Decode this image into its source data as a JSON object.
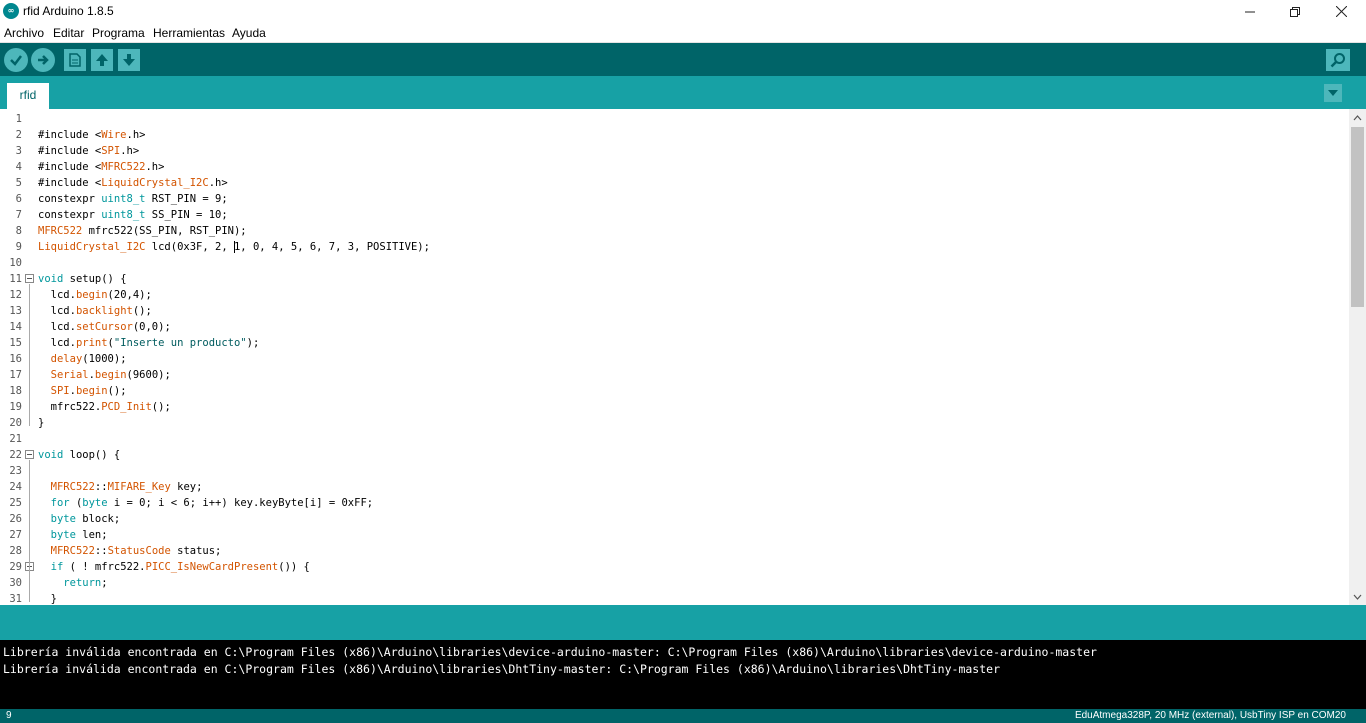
{
  "window": {
    "title": "rfid Arduino 1.8.5",
    "app_icon": "arduino-logo"
  },
  "menu": [
    "Archivo",
    "Editar",
    "Programa",
    "Herramientas",
    "Ayuda"
  ],
  "toolbar": {
    "buttons": [
      "verify-check",
      "upload-arrow",
      "new-file",
      "open-up-arrow",
      "save-down-arrow"
    ],
    "serial_monitor": "magnifier"
  },
  "tabs": [
    {
      "label": "rfid"
    }
  ],
  "editor": {
    "line_numbers": [
      "1",
      "2",
      "3",
      "4",
      "5",
      "6",
      "7",
      "8",
      "9",
      "10",
      "11",
      "12",
      "13",
      "14",
      "15",
      "16",
      "17",
      "18",
      "19",
      "20",
      "21",
      "22",
      "23",
      "24",
      "25",
      "26",
      "27",
      "28",
      "29",
      "30",
      "31"
    ],
    "lines": [
      "",
      "#include <Wire.h>",
      "#include <SPI.h>",
      "#include <MFRC522.h>",
      "#include <LiquidCrystal_I2C.h>",
      "constexpr uint8_t RST_PIN = 9;",
      "constexpr uint8_t SS_PIN = 10;",
      "MFRC522 mfrc522(SS_PIN, RST_PIN);",
      "LiquidCrystal_I2C lcd(0x3F, 2, 1, 0, 4, 5, 6, 7, 3, POSITIVE);",
      "",
      "void setup() {",
      "  lcd.begin(20,4);",
      "  lcd.backlight();",
      "  lcd.setCursor(0,0);",
      "  lcd.print(\"Inserte un producto\");",
      "  delay(1000);",
      "  Serial.begin(9600);",
      "  SPI.begin();",
      "  mfrc522.PCD_Init();",
      "}",
      "",
      "void loop() {",
      "",
      "  MFRC522::MIFARE_Key key;",
      "  for (byte i = 0; i < 6; i++) key.keyByte[i] = 0xFF;",
      "  byte block;",
      "  byte len;",
      "  MFRC522::StatusCode status;",
      "  if ( ! mfrc522.PICC_IsNewCardPresent()) {",
      "    return;",
      "  }"
    ]
  },
  "console": [
    "Librería inválida encontrada en C:\\Program Files (x86)\\Arduino\\libraries\\device-arduino-master: C:\\Program Files (x86)\\Arduino\\libraries\\device-arduino-master",
    "Librería inválida encontrada en C:\\Program Files (x86)\\Arduino\\libraries\\DhtTiny-master: C:\\Program Files (x86)\\Arduino\\libraries\\DhtTiny-master"
  ],
  "footer": {
    "line": "9",
    "board": "EduAtmega328P, 20 MHz (external), UsbTiny ISP en COM20"
  },
  "colors": {
    "toolbar": "#006468",
    "tabbar": "#17a1a5",
    "keyword": "#00979c",
    "function": "#d35400"
  }
}
